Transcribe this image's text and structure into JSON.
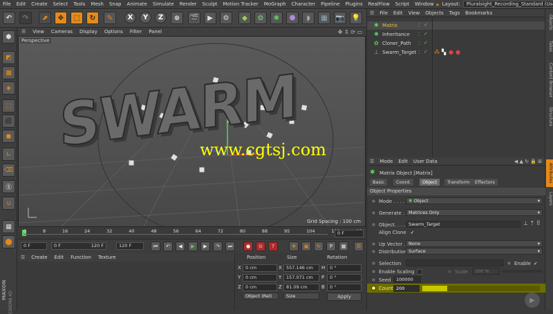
{
  "menu": [
    "File",
    "Edit",
    "Create",
    "Select",
    "Tools",
    "Mesh",
    "Snap",
    "Animate",
    "Simulate",
    "Render",
    "Sculpt",
    "Motion Tracker",
    "MoGraph",
    "Character",
    "Pipeline",
    "Plugins",
    "RealFlow",
    "Script",
    "Window"
  ],
  "layout": {
    "label": "Layout:",
    "value": "Pluralsight_Recording_Standard (User)"
  },
  "toolbar_axes": [
    "X",
    "Y",
    "Z"
  ],
  "viewport": {
    "menu": [
      "View",
      "Cameras",
      "Display",
      "Options",
      "Filter",
      "Panel"
    ],
    "camera_label": "Perspective",
    "text3d": "SWARM",
    "watermark": "www.cgtsj.com",
    "grid_spacing": "Grid Spacing : 100 cm"
  },
  "timeline": {
    "ticks": [
      "0",
      "8",
      "16",
      "24",
      "32",
      "40",
      "48",
      "56",
      "64",
      "72",
      "80",
      "88",
      "95",
      "104",
      "112",
      "12"
    ],
    "frame": "0 F"
  },
  "transport": {
    "start": "0 F",
    "min": "0 F",
    "max": "120 F",
    "end": "120 F"
  },
  "material_menu": [
    "Create",
    "Edit",
    "Function",
    "Texture"
  ],
  "coords": {
    "headers": [
      "Position",
      "Size",
      "Rotation"
    ],
    "rows": [
      {
        "axis": "X",
        "pos": "0 cm",
        "size": "557.146 cm",
        "rot_label": "H",
        "rot": "0 °"
      },
      {
        "axis": "Y",
        "pos": "0 cm",
        "size": "157.071 cm",
        "rot_label": "P",
        "rot": "0 °"
      },
      {
        "axis": "Z",
        "pos": "0 cm",
        "size": "81.09 cm",
        "rot_label": "B",
        "rot": "0 °"
      }
    ],
    "mode": "Object (Rel)",
    "size_mode": "Size",
    "apply": "Apply"
  },
  "objmgr": {
    "menu": [
      "File",
      "Edit",
      "View",
      "Objects",
      "Tags",
      "Bookmarks"
    ],
    "objects": [
      {
        "name": "Matrix",
        "color": "#e8c54a"
      },
      {
        "name": "Inheritance",
        "color": "#d0d0d0"
      },
      {
        "name": "Cloner_Path",
        "color": "#d0d0d0"
      },
      {
        "name": "Swarm_Target",
        "color": "#d0d0d0"
      }
    ]
  },
  "sidetabs_top": [
    "Objects",
    "Takes",
    "Content Browser",
    "Structure"
  ],
  "sidetabs_bottom": [
    "Attributes",
    "Layers"
  ],
  "attributes": {
    "menu": [
      "Mode",
      "Edit",
      "User Data"
    ],
    "title": "Matrix Object [Matrix]",
    "tabs": [
      "Basic",
      "Coord.",
      "Object",
      "Transform",
      "Effectors"
    ],
    "active_tab": "Object",
    "section": "Object Properties",
    "rows": {
      "mode": {
        "label": "Mode . . . . . .",
        "value": "Object"
      },
      "generate": {
        "label": "Generate . .",
        "value": "Matrices Only"
      },
      "object": {
        "label": "Object. . . . .",
        "value": "Swarm_Target"
      },
      "align_clone": {
        "label": "Align Clone"
      },
      "up_vector": {
        "label": "Up Vector . .",
        "value": "None"
      },
      "distribution": {
        "label": "Distribution",
        "value": "Surface"
      },
      "selection": {
        "label": "Selection"
      },
      "enable": {
        "label": "Enable"
      },
      "enable_scaling": {
        "label": "Enable Scaling"
      },
      "scale": {
        "label": "Scale",
        "value": "100 %"
      },
      "seed": {
        "label": "Seed",
        "value": "100000"
      },
      "count": {
        "label": "Count",
        "value": "200"
      }
    }
  },
  "brand": {
    "line1": "MAXON",
    "line2": "CINEMA 4D"
  }
}
